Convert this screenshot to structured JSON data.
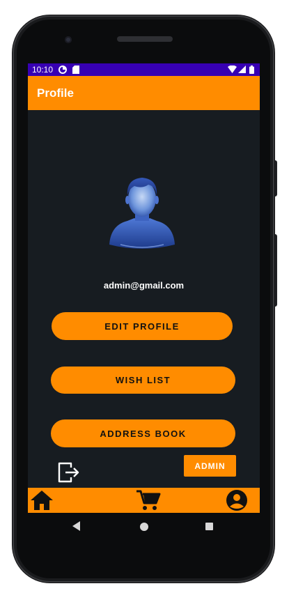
{
  "status_bar": {
    "time": "10:10",
    "icons": [
      "data-saver-icon",
      "sd-card-icon",
      "wifi-icon",
      "signal-icon",
      "battery-icon"
    ],
    "background": "#3700b3"
  },
  "app_bar": {
    "title": "Profile",
    "background": "#ff8c00"
  },
  "profile": {
    "avatar_icon": "user-avatar-icon",
    "email": "admin@gmail.com"
  },
  "buttons": {
    "edit_profile": "EDIT PROFILE",
    "wish_list": "WISH LIST",
    "address_book": "ADDRESS BOOK",
    "admin": "ADMIN",
    "logout_icon": "logout-icon"
  },
  "bottom_nav": {
    "items": [
      {
        "icon": "home-icon"
      },
      {
        "icon": "cart-icon"
      },
      {
        "icon": "account-icon"
      }
    ]
  },
  "theme": {
    "accent": "#ff8c00",
    "screen_background": "#171c21",
    "text_dark": "#111111"
  }
}
